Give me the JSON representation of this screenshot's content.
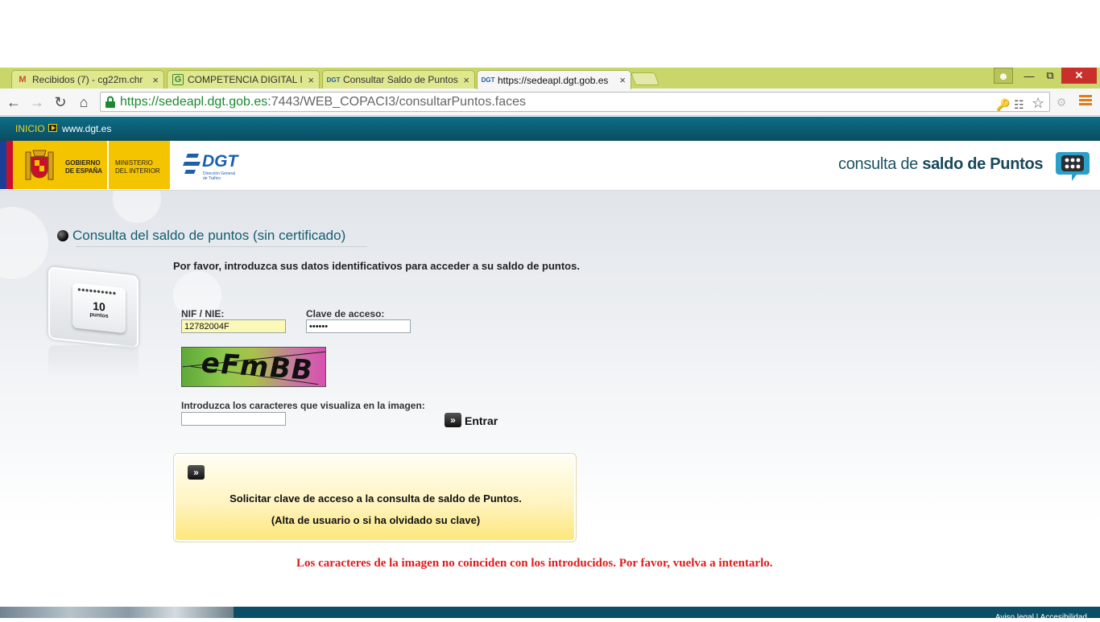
{
  "browser": {
    "tabs": [
      {
        "title": "Recibidos (7) - cg22m.chr",
        "icon": "gmail-icon",
        "active": false
      },
      {
        "title": "COMPETENCIA DIGITAL III",
        "icon": "g-icon",
        "active": false
      },
      {
        "title": "Consultar Saldo de Puntos",
        "icon": "dgt-icon",
        "active": false
      },
      {
        "title": "https://sedeapl.dgt.gob.es",
        "icon": "dgt-icon",
        "active": true
      }
    ],
    "tab_close": "×",
    "address": {
      "scheme": "https://",
      "host": "sedeapl.dgt.gob.es",
      "path": ":7443/WEB_COPACI3/consultarPuntos.faces"
    },
    "accent": "#1a8a2e"
  },
  "site": {
    "topbar": {
      "inicio": "INICIO",
      "www": "www.dgt.es"
    },
    "gov": {
      "line1": "GOBIERNO",
      "line2": "DE ESPAÑA",
      "line3": "MINISTERIO",
      "line4": "DEL INTERIOR"
    },
    "dgt": {
      "name": "DGT",
      "sub1": "Dirección General",
      "sub2": "de Tráfico"
    },
    "header_title": {
      "pre": "consulta de ",
      "bold": "saldo de Puntos"
    },
    "section_title": "Consulta del saldo de puntos (sin certificado)",
    "points_card": {
      "number": "10",
      "label": "puntos",
      "dots": "●●●●●●●●●●"
    },
    "intro": "Por favor, introduzca sus datos identificativos para acceder a su saldo de puntos.",
    "form": {
      "nif_label": "NIF / NIE:",
      "nif_value": "12782004F",
      "clave_label": "Clave de acceso:",
      "clave_value": "••••••",
      "captcha_text": "eFmBB",
      "captcha_label": "Introduzca los caracteres que visualiza en la imagen:",
      "captcha_value": "",
      "submit_label": "Entrar"
    },
    "request": {
      "line1": "Solicitar clave de acceso a la consulta de saldo de Puntos.",
      "line2": "(Alta de usuario o si ha olvidado su clave)"
    },
    "error": "Los caracteres de la imagen no coinciden con los introducidos. Por favor, vuelva a intentarlo.",
    "footer": "Aviso legal | Accesibilidad",
    "colors": {
      "teal": "#0b5a70",
      "yellow": "#f5c400",
      "error": "#e01b1b"
    }
  }
}
